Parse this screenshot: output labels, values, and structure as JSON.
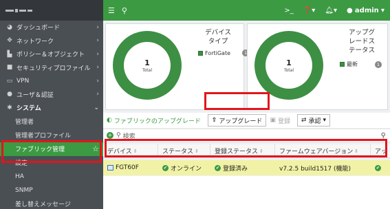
{
  "sidebar": {
    "items": [
      {
        "label": "ダッシュボード",
        "icon": "dashboard-icon"
      },
      {
        "label": "ネットワーク",
        "icon": "network-icon"
      },
      {
        "label": "ポリシー＆オブジェクト",
        "icon": "policy-icon"
      },
      {
        "label": "セキュリティプロファイル",
        "icon": "lock-icon"
      },
      {
        "label": "VPN",
        "icon": "monitor-icon"
      },
      {
        "label": "ユーザ＆認証",
        "icon": "user-icon"
      },
      {
        "label": "システム",
        "icon": "gear-icon"
      }
    ],
    "sub": [
      "管理者",
      "管理者プロファイル",
      "ファブリック管理",
      "設定",
      "HA",
      "SNMP",
      "差し替えメッセージ"
    ]
  },
  "topbar": {
    "admin_label": "admin"
  },
  "widgets": {
    "devices": {
      "title_lines": [
        "デバイス",
        "タイプ"
      ],
      "total": "1",
      "total_label": "Total",
      "legend": "FortiGate",
      "badge": "1"
    },
    "upgrade": {
      "title_lines": [
        "アップグ",
        "レードス",
        "テータス"
      ],
      "total": "1",
      "total_label": "Total",
      "legend": "最新",
      "badge": "1"
    }
  },
  "toolbar": {
    "fabric_upgrade": "ファブリックのアップグレード",
    "upgrade": "アップグレード",
    "register": "登録",
    "approve": "承認"
  },
  "search": {
    "placeholder": "検索"
  },
  "table": {
    "headers": [
      "デバイス",
      "ステータス",
      "登録ステータス",
      "ファームウェアバージョン",
      "アッ"
    ],
    "row": {
      "device": "FGT60F",
      "status": "オンライン",
      "registration": "登録済み",
      "firmware": "v7.2.5 build1517 (機能)"
    }
  },
  "colors": {
    "accent": "#3c9a43",
    "highlight": "#e3141b",
    "row_selected": "#f1f2a6"
  }
}
